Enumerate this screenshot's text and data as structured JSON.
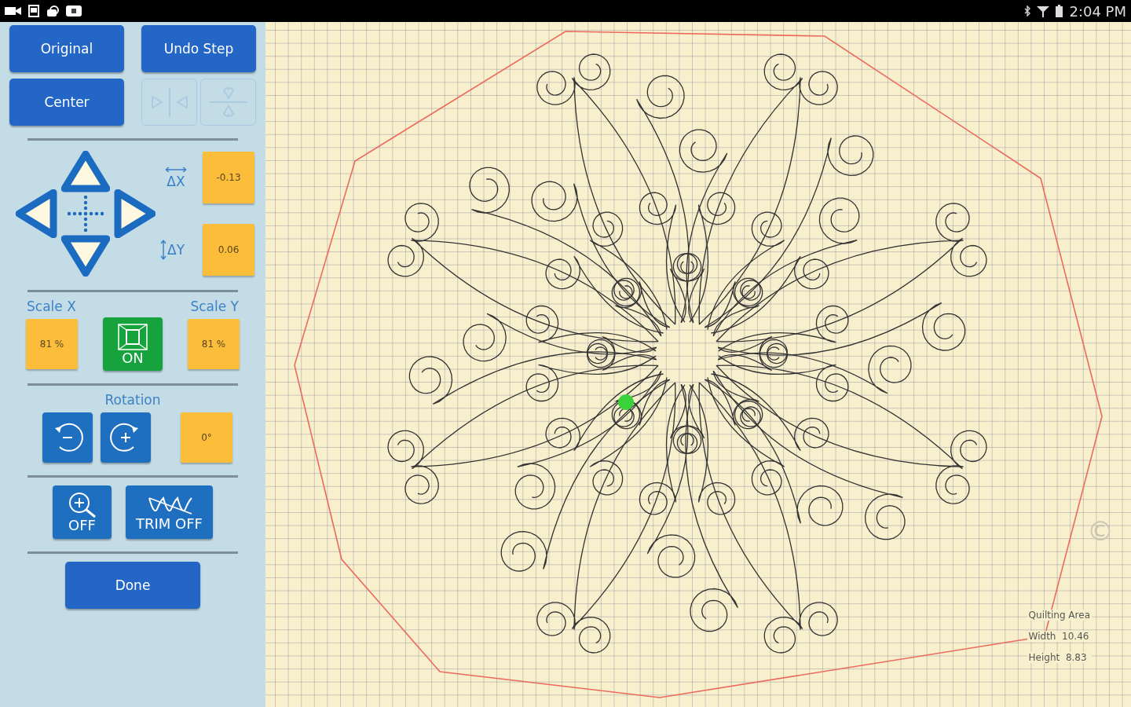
{
  "status_bar": {
    "time": "2:04 PM"
  },
  "panel": {
    "top_buttons": [
      {
        "label": "Original"
      },
      {
        "label": "Undo Step"
      },
      {
        "label": "Center"
      }
    ],
    "mirror_buttons": [
      {
        "kind": "mirror-horizontal",
        "disabled": true
      },
      {
        "kind": "mirror-vertical",
        "disabled": true
      }
    ],
    "offsets": [
      {
        "label": "ΔX",
        "value": "-0.13"
      },
      {
        "label": "ΔY",
        "value": "0.06"
      }
    ],
    "scale_x": {
      "label": "Scale X",
      "value": "81 %"
    },
    "scale_lock": {
      "label": "ON",
      "on": true
    },
    "scale_y": {
      "label": "Scale Y",
      "value": "81 %"
    },
    "rotation": {
      "label": "Rotation",
      "value": "0°"
    },
    "toggles": [
      {
        "kind": "zoom",
        "label": "OFF",
        "on": false
      },
      {
        "kind": "trim",
        "label": "TRIM OFF",
        "on": false
      }
    ],
    "done": {
      "label": "Done"
    }
  },
  "canvas": {
    "mark": "©",
    "info": [
      "Quilting Area",
      "Width  10.46",
      "Height  8.83"
    ]
  }
}
